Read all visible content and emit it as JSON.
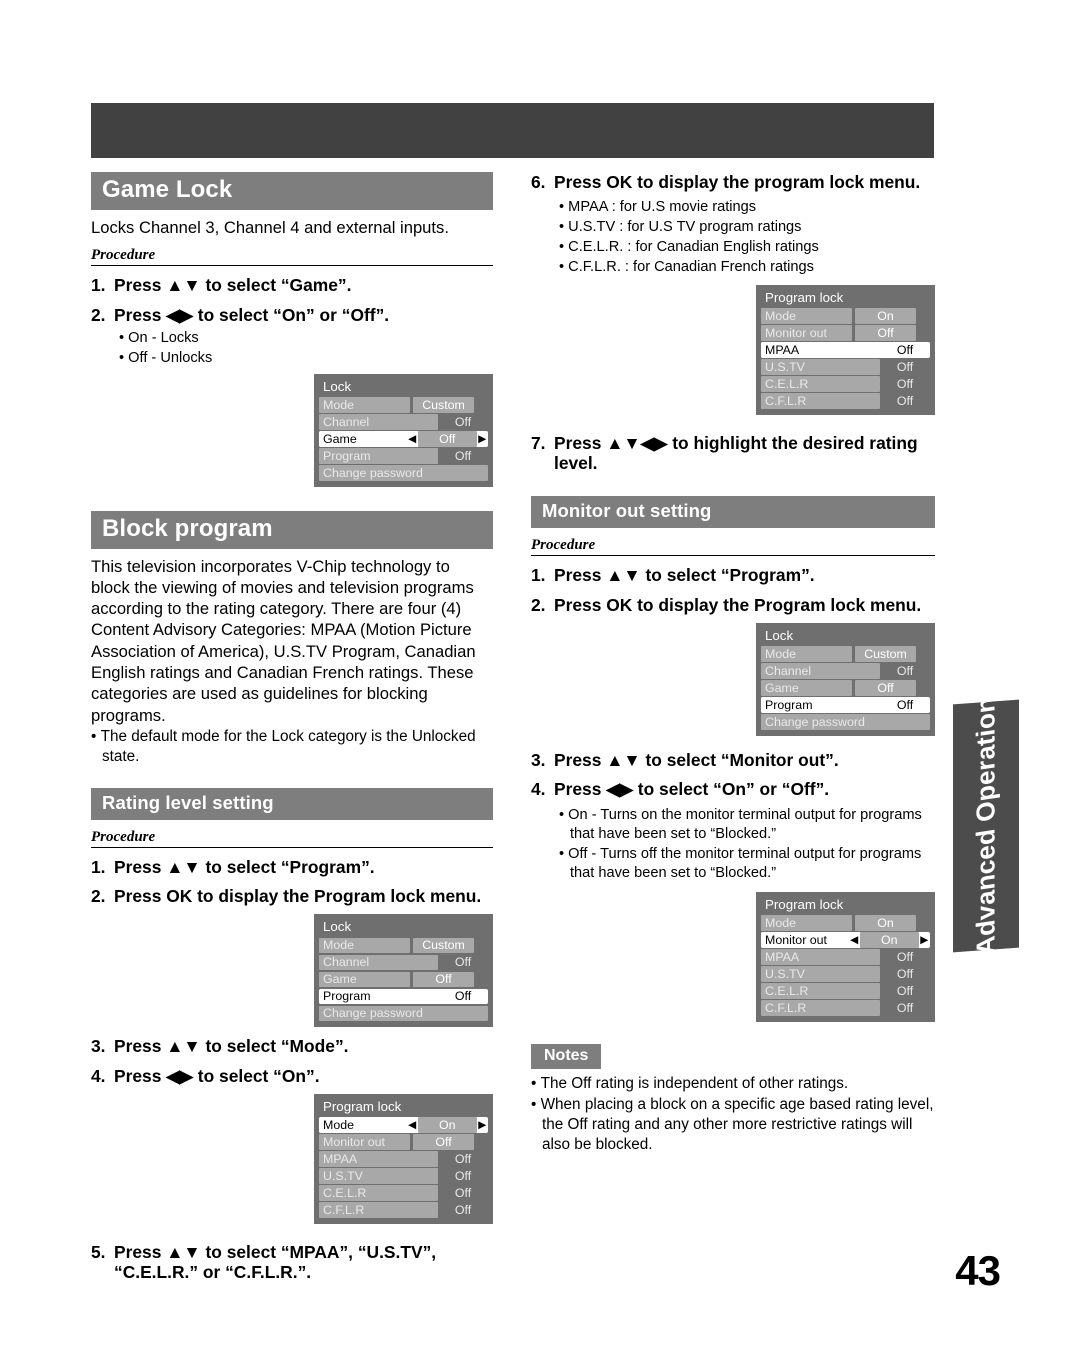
{
  "page": {
    "number": "43",
    "side_tab": "Advanced Operation"
  },
  "left_column": {
    "game_lock": {
      "heading": "Game Lock",
      "intro": "Locks Channel 3, Channel 4 and external inputs.",
      "procedure_label": "Procedure",
      "steps": [
        {
          "num": "1.",
          "text": "Press ▲▼ to select “Game”."
        },
        {
          "num": "2.",
          "text": "Press ◀▶ to select “On” or “Off”."
        }
      ],
      "bullets": [
        "On - Locks",
        "Off - Unlocks"
      ],
      "osd": {
        "title": "Lock",
        "rows": [
          {
            "label": "Mode",
            "value": "Custom",
            "style": "chip",
            "selected": false
          },
          {
            "label": "Channel",
            "value": "Off",
            "style": "plain",
            "selected": false
          },
          {
            "label": "Game",
            "value": "Off",
            "style": "selected",
            "selected": true
          },
          {
            "label": "Program",
            "value": "Off",
            "style": "plain",
            "selected": false
          },
          {
            "label": "Change password",
            "value": "",
            "style": "full",
            "selected": false
          }
        ]
      }
    },
    "block_program": {
      "heading": "Block program",
      "paragraph": "This television incorporates V-Chip technology to block the viewing of movies and television programs according to the rating category. There are four (4) Content Advisory Categories: MPAA (Motion Picture Association of America), U.S.TV Program, Canadian English ratings and Canadian French ratings. These categories are used as guidelines for blocking programs.",
      "bullets": [
        "The default mode for the Lock category is the Unlocked state."
      ]
    },
    "rating_level_setting": {
      "heading": "Rating level setting",
      "procedure_label": "Procedure",
      "steps_a": [
        {
          "num": "1.",
          "text": "Press ▲▼ to select “Program”."
        },
        {
          "num": "2.",
          "text": "Press OK to display the Program lock menu."
        }
      ],
      "osd_lock": {
        "title": "Lock",
        "rows": [
          {
            "label": "Mode",
            "value": "Custom",
            "style": "chip",
            "selected": false
          },
          {
            "label": "Channel",
            "value": "Off",
            "style": "plain",
            "selected": false
          },
          {
            "label": "Game",
            "value": "Off",
            "style": "chip",
            "selected": false
          },
          {
            "label": "Program",
            "value": "Off",
            "style": "selected-plain",
            "selected": true
          },
          {
            "label": "Change password",
            "value": "",
            "style": "full",
            "selected": false
          }
        ]
      },
      "steps_b": [
        {
          "num": "3.",
          "text": "Press ▲▼ to select “Mode”."
        },
        {
          "num": "4.",
          "text": "Press ◀▶ to select “On”."
        }
      ],
      "osd_program_lock": {
        "title": "Program lock",
        "rows": [
          {
            "label": "Mode",
            "value": "On",
            "style": "selected",
            "selected": true
          },
          {
            "label": "Monitor out",
            "value": "Off",
            "style": "chip",
            "selected": false
          },
          {
            "label": "MPAA",
            "value": "Off",
            "style": "plain",
            "selected": false
          },
          {
            "label": "U.S.TV",
            "value": "Off",
            "style": "plain",
            "selected": false
          },
          {
            "label": "C.E.L.R",
            "value": "Off",
            "style": "plain",
            "selected": false
          },
          {
            "label": "C.F.L.R",
            "value": "Off",
            "style": "plain",
            "selected": false
          }
        ]
      },
      "steps_c": [
        {
          "num": "5.",
          "text": "Press ▲▼ to select “MPAA”, “U.S.TV”, “C.E.L.R.” or “C.F.L.R.”."
        }
      ]
    }
  },
  "right_column": {
    "step6": {
      "num": "6.",
      "text": "Press OK to display the program lock menu.",
      "bullets": [
        "MPAA : for U.S movie ratings",
        "U.S.TV : for U.S TV program ratings",
        "C.E.L.R. : for Canadian English ratings",
        "C.F.L.R. : for Canadian French ratings"
      ],
      "osd_program_lock": {
        "title": "Program lock",
        "rows": [
          {
            "label": "Mode",
            "value": "On",
            "style": "chip",
            "selected": false
          },
          {
            "label": "Monitor out",
            "value": "Off",
            "style": "chip",
            "selected": false
          },
          {
            "label": "MPAA",
            "value": "Off",
            "style": "selected-plain",
            "selected": true
          },
          {
            "label": "U.S.TV",
            "value": "Off",
            "style": "plain",
            "selected": false
          },
          {
            "label": "C.E.L.R",
            "value": "Off",
            "style": "plain",
            "selected": false
          },
          {
            "label": "C.F.L.R",
            "value": "Off",
            "style": "plain",
            "selected": false
          }
        ]
      }
    },
    "step7": {
      "num": "7.",
      "text": "Press ▲▼◀▶ to highlight the desired rating level."
    },
    "monitor_out_setting": {
      "heading": "Monitor out setting",
      "procedure_label": "Procedure",
      "steps_a": [
        {
          "num": "1.",
          "text": "Press ▲▼ to select “Program”."
        },
        {
          "num": "2.",
          "text": "Press OK to display the Program lock menu."
        }
      ],
      "osd_lock": {
        "title": "Lock",
        "rows": [
          {
            "label": "Mode",
            "value": "Custom",
            "style": "chip",
            "selected": false
          },
          {
            "label": "Channel",
            "value": "Off",
            "style": "plain",
            "selected": false
          },
          {
            "label": "Game",
            "value": "Off",
            "style": "chip",
            "selected": false
          },
          {
            "label": "Program",
            "value": "Off",
            "style": "selected-plain",
            "selected": true
          },
          {
            "label": "Change password",
            "value": "",
            "style": "full",
            "selected": false
          }
        ]
      },
      "steps_b": [
        {
          "num": "3.",
          "text": "Press ▲▼ to select “Monitor out”."
        },
        {
          "num": "4.",
          "text": "Press ◀▶ to select “On” or “Off”."
        }
      ],
      "bullets": [
        "On - Turns on the monitor terminal output for programs that have been set to “Blocked.”",
        "Off - Turns off the monitor terminal output for programs that have been set to “Blocked.”"
      ],
      "osd_program_lock": {
        "title": "Program lock",
        "rows": [
          {
            "label": "Mode",
            "value": "On",
            "style": "chip",
            "selected": false
          },
          {
            "label": "Monitor out",
            "value": "On",
            "style": "selected",
            "selected": true
          },
          {
            "label": "MPAA",
            "value": "Off",
            "style": "plain",
            "selected": false
          },
          {
            "label": "U.S.TV",
            "value": "Off",
            "style": "plain",
            "selected": false
          },
          {
            "label": "C.E.L.R",
            "value": "Off",
            "style": "plain",
            "selected": false
          },
          {
            "label": "C.F.L.R",
            "value": "Off",
            "style": "plain",
            "selected": false
          }
        ]
      }
    },
    "notes": {
      "heading": "Notes",
      "bullets": [
        "The Off rating is independent of other ratings.",
        "When placing a block on a specific age based rating level, the Off rating and any other more restrictive ratings will also be blocked."
      ]
    }
  },
  "colors": {
    "header_bar": "#414141",
    "section_bar": "#7e7e7e",
    "osd_background": "#6f6f6f",
    "osd_item": "#a8a8a8",
    "side_tab": "#4c4c4c"
  }
}
